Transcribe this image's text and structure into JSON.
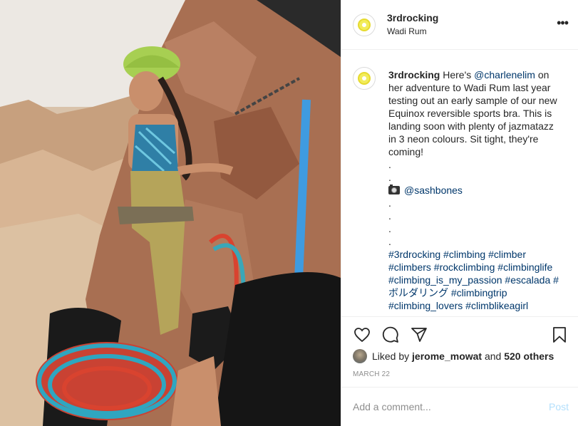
{
  "post": {
    "username": "3rdrocking",
    "location": "Wadi Rum",
    "more_icon": "more-horizontal-icon",
    "caption": {
      "username": "3rdrocking",
      "text_1": " Here's ",
      "mention_1": "@charlenelim",
      "text_2": " on her adventure to Wadi Rum last year testing out an early sample of our new Equinox reversible sports bra. This is landing soon with plenty of jazmatazz in 3 neon colours. Sit tight, they're coming!",
      "dots_a": [
        ".",
        "."
      ],
      "camera_icon": "camera-icon",
      "mention_2": "@sashbones",
      "dots_b": [
        ".",
        ".",
        ".",
        "."
      ],
      "hashtags": [
        "#3rdrocking",
        "#climbing",
        "#climber",
        "#climbers",
        "#rockclimbing",
        "#climbinglife",
        "#climbing_is_my_passion",
        "#escalada",
        "#",
        "ボルダリング",
        "#climbingtrip",
        "#climbing_lovers",
        "#climblikeagirl"
      ]
    },
    "actions": {
      "like_icon": "heart-icon",
      "comment_icon": "comment-icon",
      "share_icon": "share-icon",
      "save_icon": "bookmark-icon"
    },
    "likes": {
      "prefix": "Liked by ",
      "user": "jerome_mowat",
      "middle": " and ",
      "others": "520 others"
    },
    "date": "MARCH 22",
    "comment_box": {
      "placeholder": "Add a comment...",
      "post_label": "Post"
    }
  }
}
